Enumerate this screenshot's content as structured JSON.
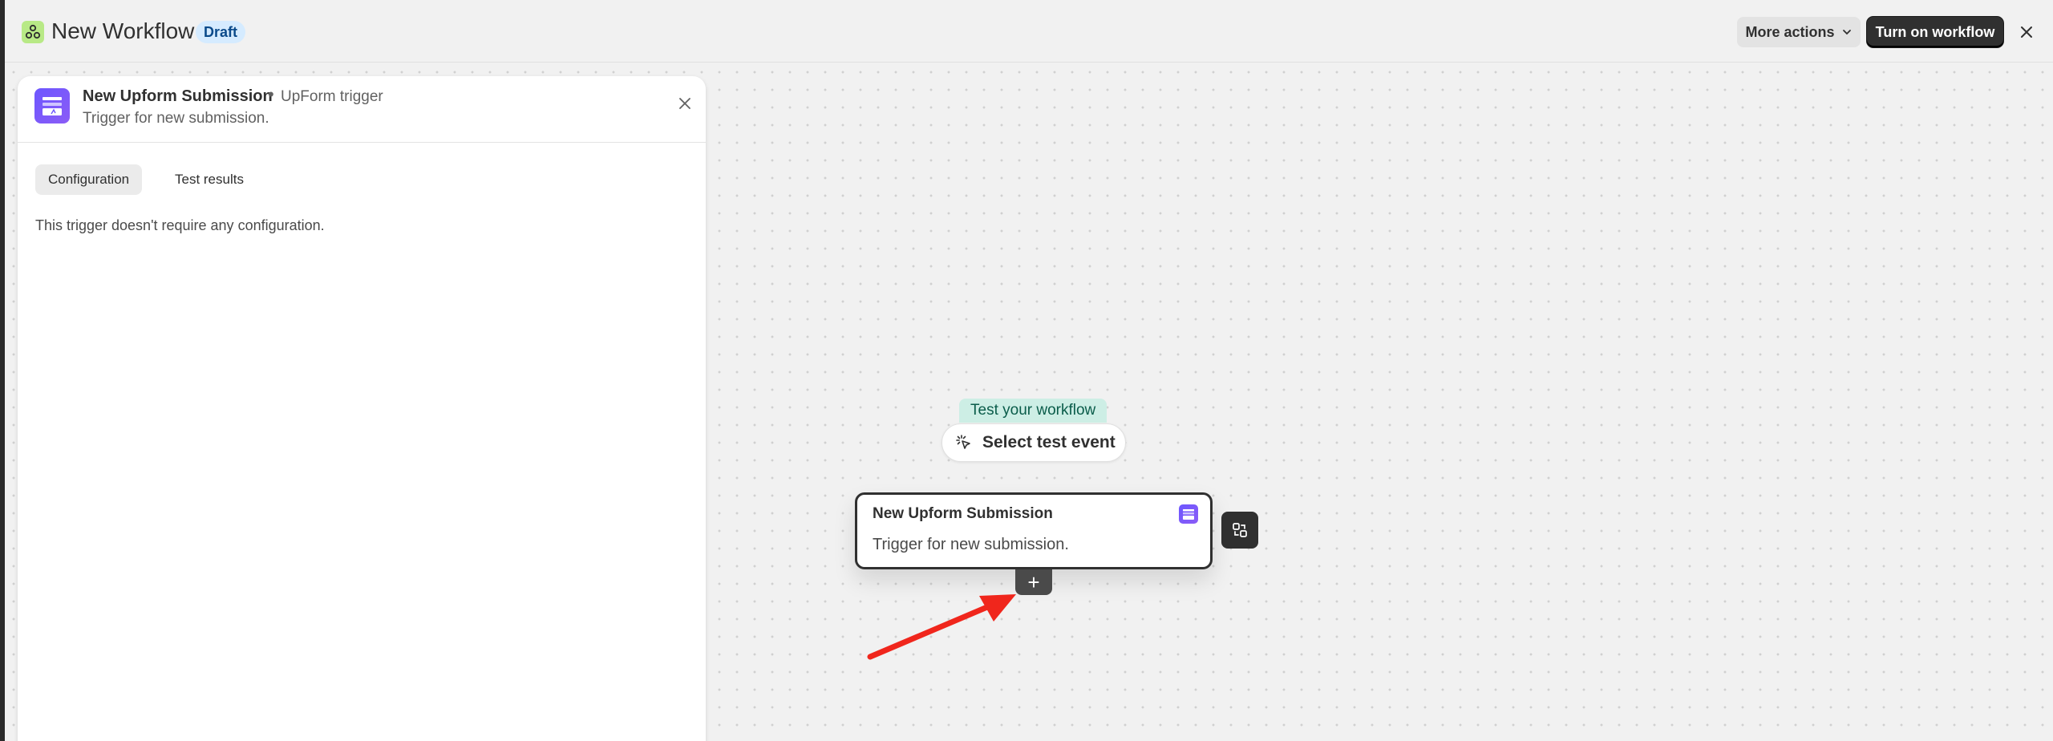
{
  "header": {
    "title": "New Workflow",
    "status_badge": "Draft",
    "more_actions_label": "More actions",
    "turn_on_label": "Turn on workflow"
  },
  "panel": {
    "title": "New Upform Submission",
    "separator": "•",
    "subtitle": "UpForm trigger",
    "description": "Trigger for new submission.",
    "tabs": [
      {
        "label": "Configuration",
        "active": true
      },
      {
        "label": "Test results",
        "active": false
      }
    ],
    "body_text": "This trigger doesn't require any configuration."
  },
  "canvas": {
    "test_label": "Test your workflow",
    "select_test_label": "Select test event",
    "node": {
      "title": "New Upform Submission",
      "description": "Trigger for new submission."
    },
    "add_symbol": "+"
  },
  "colors": {
    "primary_button": "#303030",
    "draft_badge_bg": "#d5ebff",
    "test_label_bg": "#cdeee5",
    "app_icon": "#6d57ff",
    "annotation_arrow": "#f0261c"
  },
  "icons": {
    "logo": "workflow-logo-icon",
    "chevron": "chevron-down-icon",
    "close": "close-icon",
    "pointer": "pointer-click-icon",
    "swap": "swap-icon"
  }
}
